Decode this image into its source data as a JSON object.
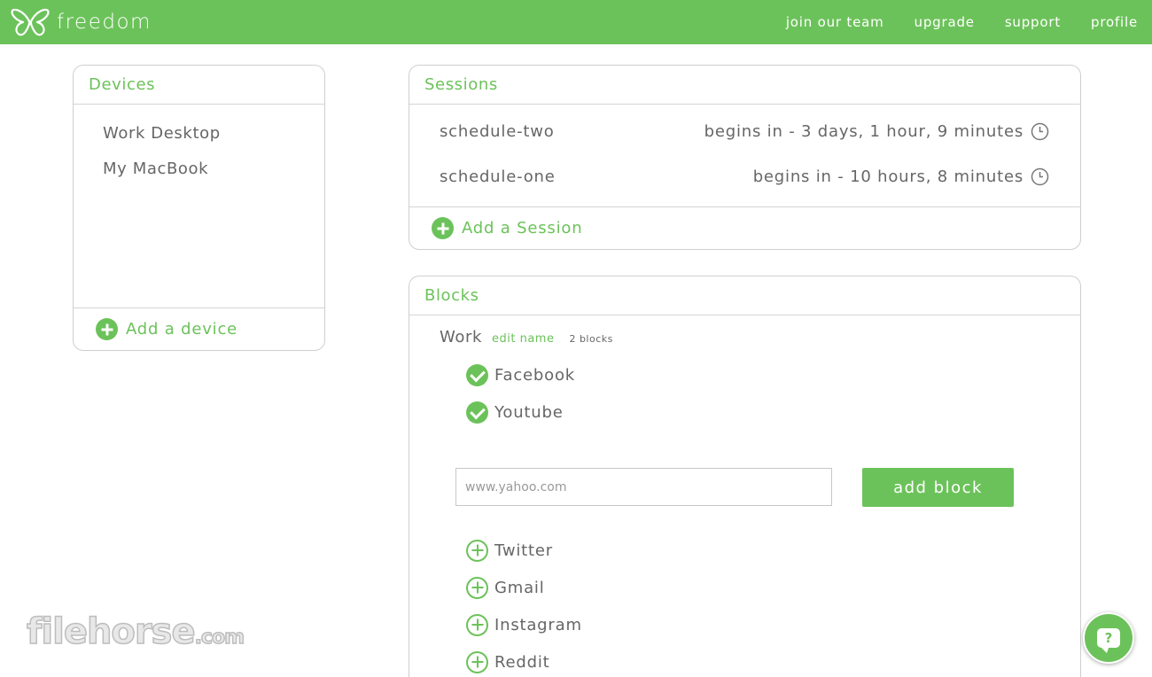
{
  "topbar": {
    "brand": "freedom",
    "nav": [
      "join our team",
      "upgrade",
      "support",
      "profile"
    ]
  },
  "devices": {
    "title": "Devices",
    "items": [
      "Work Desktop",
      "My MacBook"
    ],
    "add_label": "Add a device"
  },
  "sessions": {
    "title": "Sessions",
    "items": [
      {
        "name": "schedule-two",
        "time": "begins in - 3 days, 1 hour, 9 minutes"
      },
      {
        "name": "schedule-one",
        "time": "begins in - 10 hours, 8 minutes"
      }
    ],
    "add_label": "Add a Session"
  },
  "blocks": {
    "title": "Blocks",
    "group_name": "Work",
    "edit_label": "edit name",
    "count_label": "2 blocks",
    "active_sites": [
      "Facebook",
      "Youtube"
    ],
    "input_placeholder": "www.yahoo.com",
    "add_button": "add block",
    "suggested_sites": [
      "Twitter",
      "Gmail",
      "Instagram",
      "Reddit"
    ]
  },
  "watermark": {
    "main": "filehorse",
    "suffix": ".com"
  },
  "help": {
    "label": "?"
  },
  "colors": {
    "accent": "#6cc25a",
    "text": "#666666",
    "border": "#cfcfcf"
  }
}
